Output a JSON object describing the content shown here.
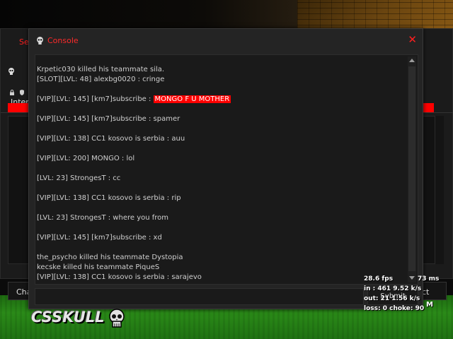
{
  "background_window": {
    "title": "Se",
    "tab": "Interr",
    "left_button": "Cha",
    "right_button": "ct"
  },
  "console": {
    "title": "Console",
    "close_icon": "close-icon",
    "submit_label": "Submit",
    "lines": [
      {
        "text": "Krpetic030 killed his teammate sila."
      },
      {
        "text": "[SLOT][LVL: 48] alexbg0020 : cringe"
      },
      {
        "gap": true
      },
      {
        "prefix": "[VIP][LVL: 145] [km7]subscribe : ",
        "highlight": "MONGO F U MOTHER"
      },
      {
        "gap": true
      },
      {
        "text": "[VIP][LVL: 145] [km7]subscribe : spamer"
      },
      {
        "gap": true
      },
      {
        "text": "[VIP][LVL: 138] CC1 kosovo is serbia : auu"
      },
      {
        "gap": true
      },
      {
        "text": "[VIP][LVL: 200] MONGO : lol"
      },
      {
        "gap": true
      },
      {
        "text": "[LVL: 23] StrongesT : cc"
      },
      {
        "gap": true
      },
      {
        "text": "[VIP][LVL: 138] CC1 kosovo is serbia : rip"
      },
      {
        "gap": true
      },
      {
        "text": "[LVL: 23] StrongesT : where you from"
      },
      {
        "gap": true
      },
      {
        "text": "[VIP][LVL: 145] [km7]subscribe : xd"
      },
      {
        "gap": true
      },
      {
        "text": "the_psycho killed his teammate Dystopia"
      },
      {
        "text": "kecske killed his teammate PiqueS"
      },
      {
        "text": "[VIP][LVL: 138] CC1 kosovo is serbia : sarajevo"
      }
    ]
  },
  "netgraph": {
    "fps": "28.6 fps",
    "ms": "73 ms",
    "in": "in :  461 9.52 k/s",
    "out": "out: 21 1.56 k/s",
    "loss": "loss: 0 choke:  90",
    "m": "M"
  },
  "logo": {
    "text": "CSSKULL",
    "icon": "skull-icon"
  },
  "colors": {
    "accent_red": "#ff0000",
    "title_red": "#ff2a2a",
    "grass": "#2a8a18"
  }
}
